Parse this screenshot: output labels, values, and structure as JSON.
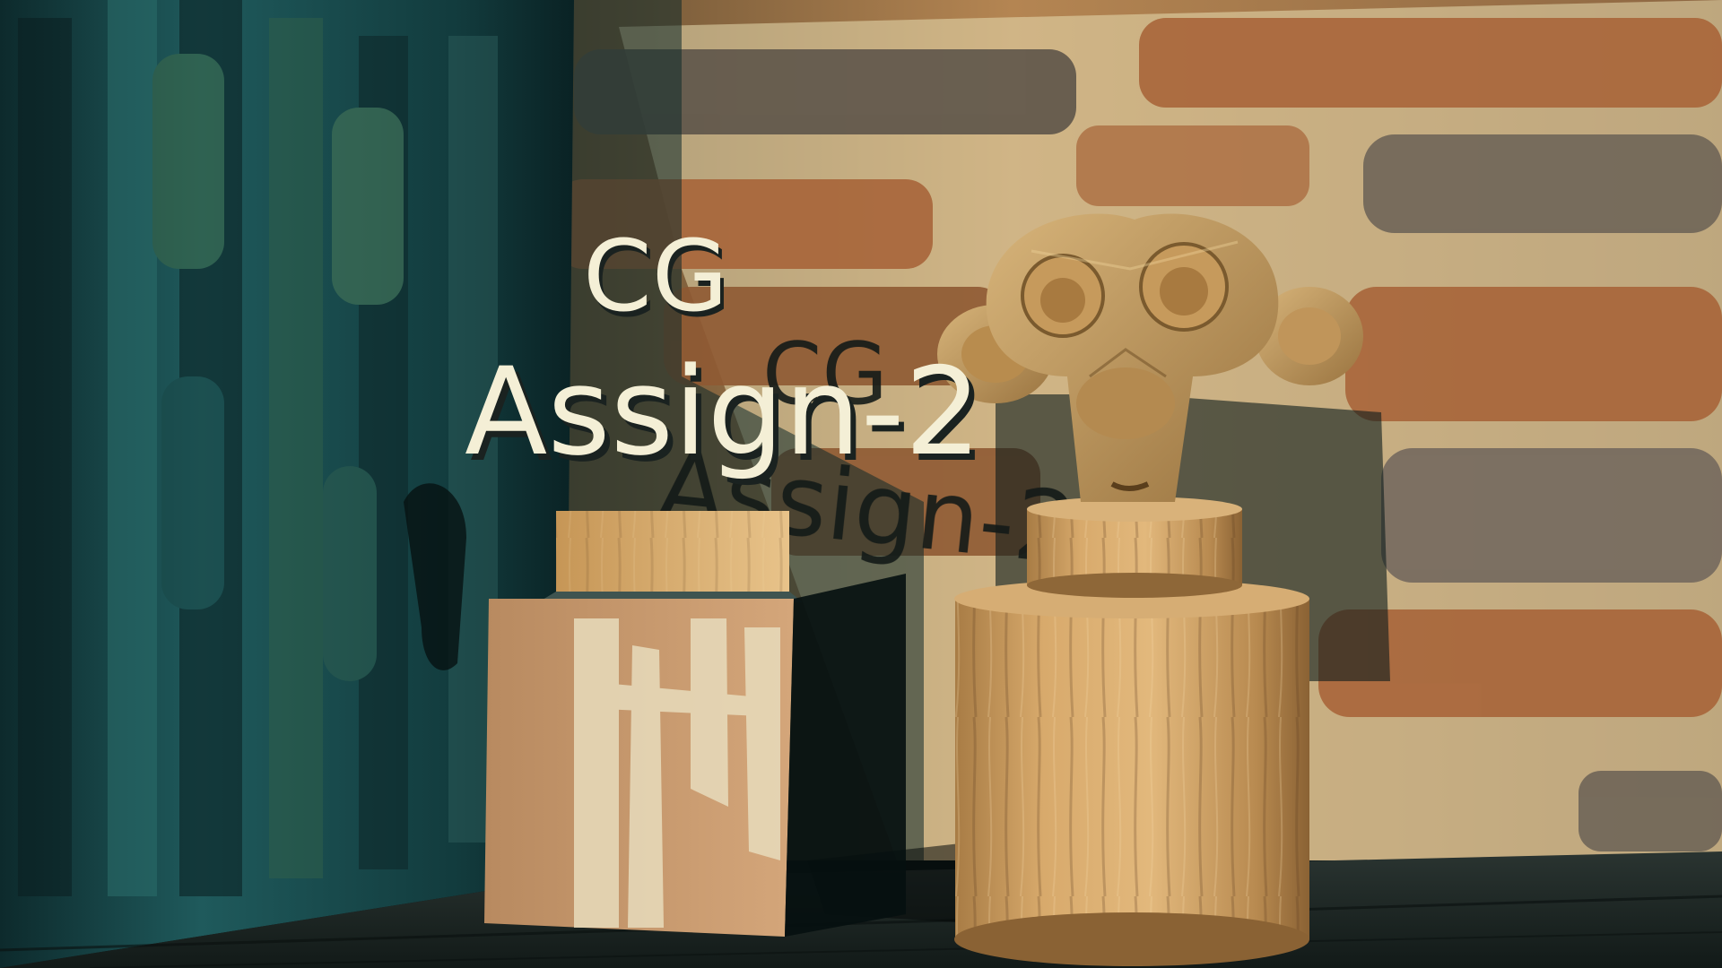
{
  "scene": {
    "title_line1": "CG",
    "title_line2": "Assign-2",
    "shadow_line1": "CG",
    "shadow_line2": "Assign-2"
  },
  "colors": {
    "left_wall_teal": "#1f5a5c",
    "brick_orange": "#a8653a",
    "mortar_cream": "#e8ddb0",
    "wood_light": "#d9a86a",
    "floor_dark": "#1a2422",
    "title_fill": "#f4efd6"
  },
  "icons": {
    "monkey": "suzanne-monkey-head-icon"
  }
}
